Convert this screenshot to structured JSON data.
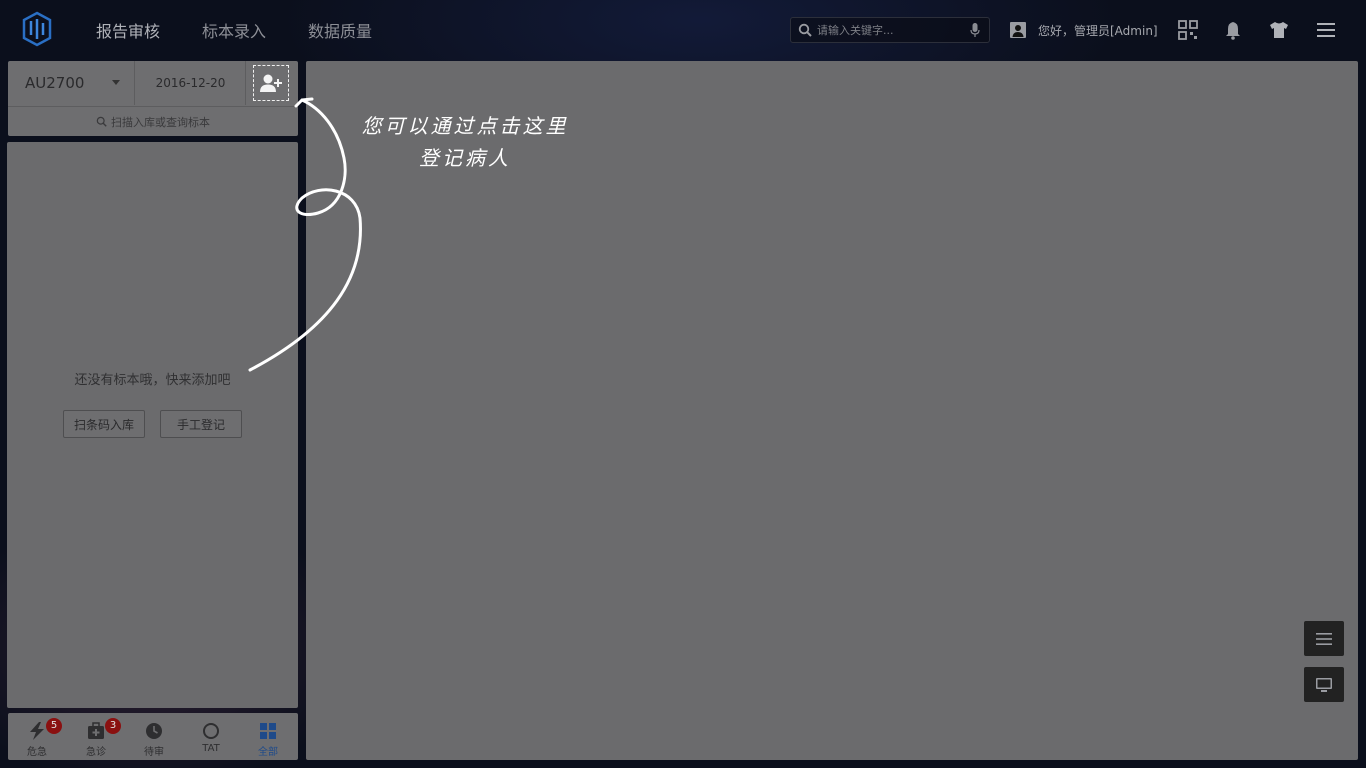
{
  "header": {
    "nav": [
      "报告审核",
      "标本录入",
      "数据质量"
    ],
    "active_nav": "报告审核",
    "search": {
      "placeholder": "请输入关键字..."
    },
    "greeting": "您好，管理员[Admin]"
  },
  "toolbar": {
    "device": "AU2700",
    "date": "2016-12-20",
    "scan_search": "扫描入库或查询标本"
  },
  "specimen_list": {
    "empty_text": "还没有标本哦，快来添加吧",
    "scan_button": "扫条码入库",
    "manual_button": "手工登记"
  },
  "filter_tabs": [
    {
      "label": "危急",
      "icon": "lightning-icon",
      "badge": "5"
    },
    {
      "label": "急诊",
      "icon": "medical-kit-icon",
      "badge": "3"
    },
    {
      "label": "待审",
      "icon": "clock-icon"
    },
    {
      "label": "TAT",
      "icon": "circle-icon"
    },
    {
      "label": "全部",
      "icon": "grid-icon",
      "active": true
    }
  ],
  "guide": {
    "line1": "您可以通过点击这里",
    "line2": "登记病人"
  },
  "colors": {
    "active_tab": "#1e4a8a",
    "badge": "#8a1010",
    "overlay_panel": "#6b6b6d"
  }
}
